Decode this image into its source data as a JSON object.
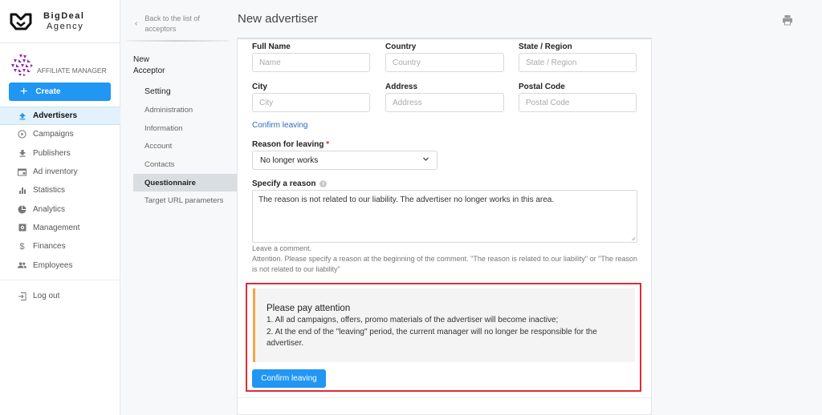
{
  "brand": {
    "line1": "BigDeal",
    "line2": "Agency"
  },
  "role": {
    "label": "AFFILIATE MANAGER"
  },
  "sidebar": {
    "create_label": "Create",
    "items": [
      {
        "label": "Advertisers",
        "icon": "upload-icon",
        "active": true
      },
      {
        "label": "Campaigns",
        "icon": "play-circle-icon"
      },
      {
        "label": "Publishers",
        "icon": "download-icon"
      },
      {
        "label": "Ad inventory",
        "icon": "ad-box-icon"
      },
      {
        "label": "Statistics",
        "icon": "bar-chart-icon"
      },
      {
        "label": "Analytics",
        "icon": "pie-chart-icon"
      },
      {
        "label": "Management",
        "icon": "settings-box-icon"
      },
      {
        "label": "Finances",
        "icon": "dollar-icon"
      },
      {
        "label": "Employees",
        "icon": "people-icon"
      }
    ],
    "logout_label": "Log out"
  },
  "subnav": {
    "back_label": "Back to the list of acceptors",
    "back_line1": "Back to the list of",
    "back_line2": "acceptors",
    "title_line1": "New",
    "title_line2": "Acceptor",
    "section": "Setting",
    "items": [
      {
        "label": "Administration"
      },
      {
        "label": "Information"
      },
      {
        "label": "Account"
      },
      {
        "label": "Contacts"
      },
      {
        "label": "Questionnaire",
        "active": true
      },
      {
        "label": "Target URL parameters"
      }
    ]
  },
  "page": {
    "title": "New advertiser",
    "print_icon": "printer-icon"
  },
  "form": {
    "full_name": {
      "label": "Full Name",
      "placeholder": "Name",
      "value": ""
    },
    "country": {
      "label": "Country",
      "placeholder": "Country",
      "value": ""
    },
    "state": {
      "label": "State / Region",
      "placeholder": "State / Region",
      "value": ""
    },
    "city": {
      "label": "City",
      "placeholder": "City",
      "value": ""
    },
    "address": {
      "label": "Address",
      "placeholder": "Address",
      "value": ""
    },
    "postal": {
      "label": "Postal Code",
      "placeholder": "Postal Code",
      "value": ""
    },
    "confirm_link": "Confirm leaving",
    "reason": {
      "label": "Reason for leaving",
      "required_mark": "*",
      "value": "No longer works"
    },
    "specify": {
      "label": "Specify a reason",
      "info_icon": "i",
      "value": "The reason is not related to our liability. The advertiser no longer works in this area."
    },
    "help_1": "Leave a comment.",
    "help_2": "Attention. Please specify a reason at the beginning of the comment. \"The reason is related to our liability\" or \"The reason is not related to our liability\""
  },
  "notice": {
    "title": "Please pay attention",
    "line1": "1. All ad campaigns, offers, promo materials of the advertiser will become inactive;",
    "line2": "2. At the end of the \"leaving\" period, the current manager will no longer be responsible for the advertiser.",
    "button": "Confirm leaving"
  },
  "colors": {
    "accent": "#2196f3",
    "highlight_border": "#e32b33",
    "notice_bar": "#f5a54a",
    "link": "#2a6dbd"
  }
}
